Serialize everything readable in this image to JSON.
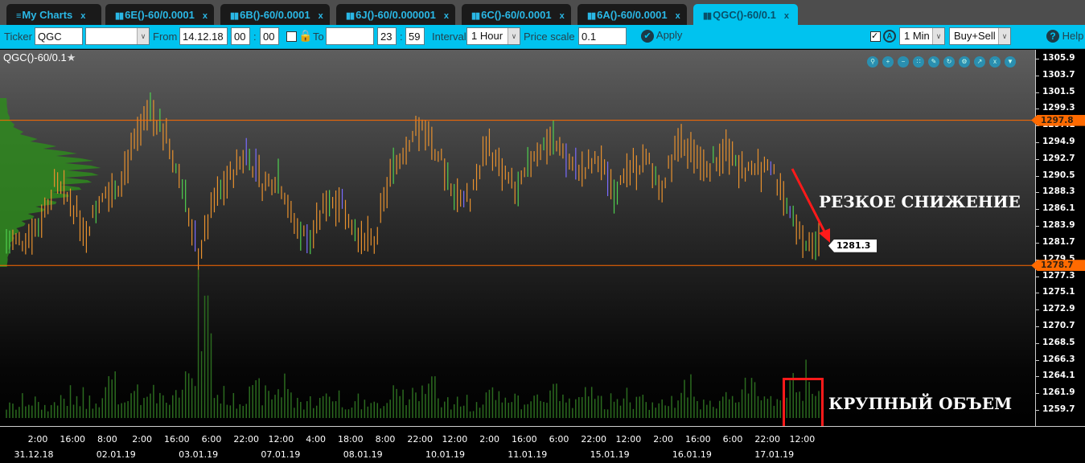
{
  "tabs": [
    {
      "label": "My Charts",
      "icon": "menu-icon"
    },
    {
      "label": "6E()-60/0.0001",
      "icon": "bar-chart-icon"
    },
    {
      "label": "6B()-60/0.0001",
      "icon": "bar-chart-icon"
    },
    {
      "label": "6J()-60/0.000001",
      "icon": "bar-chart-icon"
    },
    {
      "label": "6C()-60/0.0001",
      "icon": "bar-chart-icon"
    },
    {
      "label": "6A()-60/0.0001",
      "icon": "bar-chart-icon"
    },
    {
      "label": "QGC()-60/0.1",
      "icon": "bar-chart-icon",
      "active": true
    }
  ],
  "tab_close": "x",
  "toolbar": {
    "ticker_label": "Ticker",
    "ticker_value": "QGC",
    "ticker_select": "",
    "from_label": "From",
    "from_date": "14.12.18",
    "from_h": "00",
    "from_m": "00",
    "colon": ":",
    "to_label": "To",
    "to_date": "",
    "to_h": "23",
    "to_m": "59",
    "interval_label": "Interval",
    "interval_value": "1 Hour",
    "price_scale_label": "Price scale",
    "price_scale_value": "0.1",
    "apply_label": "Apply",
    "min_value": "1 Min",
    "side_value": "Buy+Sell",
    "help_label": "Help"
  },
  "chart_title": "QGC()-60/0.1",
  "chart_data": {
    "type": "ohlc",
    "ylim": [
      1257.5,
      1307.0
    ],
    "y_ticks": [
      "1305.9",
      "1303.7",
      "1301.5",
      "1299.3",
      "1297.1",
      "1294.9",
      "1292.7",
      "1290.5",
      "1288.3",
      "1286.1",
      "1283.9",
      "1281.7",
      "1279.5",
      "1277.3",
      "1275.1",
      "1272.9",
      "1270.7",
      "1268.5",
      "1266.3",
      "1264.1",
      "1261.9",
      "1259.7"
    ],
    "levels": [
      {
        "price": 1297.8,
        "label": "1297.8"
      },
      {
        "price": 1278.7,
        "label": "1278.7"
      }
    ],
    "last_price": {
      "price": 1281.3,
      "label": "1281.3"
    },
    "closes": [
      1281.9,
      1281.9,
      1284.0,
      1289.3,
      1287.2,
      1283.0,
      1288.3,
      1289.3,
      1294.6,
      1298.8,
      1295.6,
      1289.3,
      1279.8,
      1287.2,
      1290.4,
      1293.5,
      1289.3,
      1290.4,
      1284.0,
      1281.9,
      1287.2,
      1287.2,
      1283.0,
      1281.9,
      1290.4,
      1294.6,
      1297.2,
      1293.5,
      1288.3,
      1287.2,
      1294.6,
      1291.4,
      1288.3,
      1293.5,
      1295.1,
      1292.5,
      1291.4,
      1293.0,
      1288.3,
      1291.4,
      1292.5,
      1289.3,
      1294.6,
      1293.5,
      1291.9,
      1294.1,
      1291.4,
      1291.4,
      1290.9,
      1285.1,
      1281.9,
      1281.4
    ],
    "volume": [
      2,
      3,
      2,
      3,
      4,
      3,
      6,
      3,
      4,
      5,
      4,
      8,
      18,
      4,
      3,
      5,
      4,
      6,
      3,
      3,
      4,
      3,
      3,
      2,
      6,
      4,
      5,
      3,
      3,
      2,
      4,
      3,
      3,
      4,
      5,
      3,
      4,
      3,
      4,
      3,
      2,
      3,
      6,
      3,
      3,
      4,
      5,
      3,
      3,
      6,
      7,
      4
    ],
    "x_time_labels": [
      "2:00",
      "16:00",
      "8:00",
      "2:00",
      "16:00",
      "6:00",
      "22:00",
      "12:00",
      "4:00",
      "18:00",
      "8:00",
      "22:00",
      "12:00",
      "2:00",
      "16:00",
      "6:00",
      "22:00",
      "12:00",
      "2:00",
      "16:00",
      "6:00",
      "22:00",
      "12:00"
    ],
    "x_date_labels": [
      "31.12.18",
      "02.01.19",
      "03.01.19",
      "07.01.19",
      "08.01.19",
      "10.01.19",
      "11.01.19",
      "15.01.19",
      "16.01.19",
      "17.01.19"
    ]
  },
  "annotations": {
    "drop": "РЕЗКОЕ СНИЖЕНИЕ",
    "volume": "КРУПНЫЙ ОБЪЕМ"
  },
  "colors": {
    "accent": "#00c3ef",
    "level": "#ff6a00",
    "bar": "#e8912e",
    "annot": "#ff1a1a"
  }
}
